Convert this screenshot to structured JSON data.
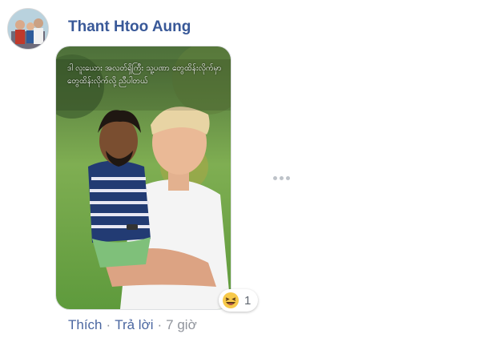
{
  "comment": {
    "author": "Thant Htoo Aung",
    "photo_caption": "ဒါ လူးယေား အလတ်ရှိကြီး သူ့ပဏာ တွေထိန်းလိုက်မှာ တွေထိန်းလိုက်လို့ ညီပါတယ်",
    "reaction": {
      "icon": "laugh-icon",
      "count": "1"
    },
    "actions": {
      "like": "Thích",
      "reply": "Trả lời",
      "time": "7 giờ",
      "separator": "·"
    }
  },
  "colors": {
    "author": "#385898",
    "action_link": "#4b67a1",
    "muted": "#90949c"
  }
}
